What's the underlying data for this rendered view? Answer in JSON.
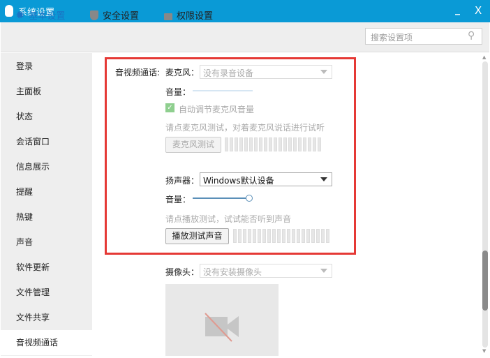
{
  "window": {
    "title": "系统设置",
    "minimize": "_",
    "close": "X"
  },
  "toolbar": {
    "tabs": [
      {
        "label": "基本设置"
      },
      {
        "label": "安全设置"
      },
      {
        "label": "权限设置"
      }
    ],
    "search_placeholder": "搜索设置项"
  },
  "sidebar": {
    "items": [
      "登录",
      "主面板",
      "状态",
      "会话窗口",
      "信息展示",
      "提醒",
      "热键",
      "声音",
      "软件更新",
      "文件管理",
      "文件共享",
      "音视频通话"
    ],
    "selected": "音视频通话"
  },
  "av": {
    "section_label": "音视频通话:",
    "mic": {
      "label": "麦克风：",
      "value": "没有录音设备",
      "volume_label": "音量：",
      "auto_adjust": "自动调节麦克风音量",
      "auto_adjust_checked": true,
      "hint": "请点麦克风测试，对着麦克风说话进行试听",
      "test_button": "麦克风测试"
    },
    "speaker": {
      "label": "扬声器：",
      "value": "Windows默认设备",
      "volume_label": "音量：",
      "volume_percent": 100,
      "hint": "请点播放测试，试试能否听到声音",
      "test_button": "播放测试声音"
    },
    "camera": {
      "label": "摄像头：",
      "value": "没有安装摄像头"
    }
  },
  "colors": {
    "titlebar": "#0a9ad6",
    "highlight": "#e53935",
    "accent": "#1a74c4"
  }
}
